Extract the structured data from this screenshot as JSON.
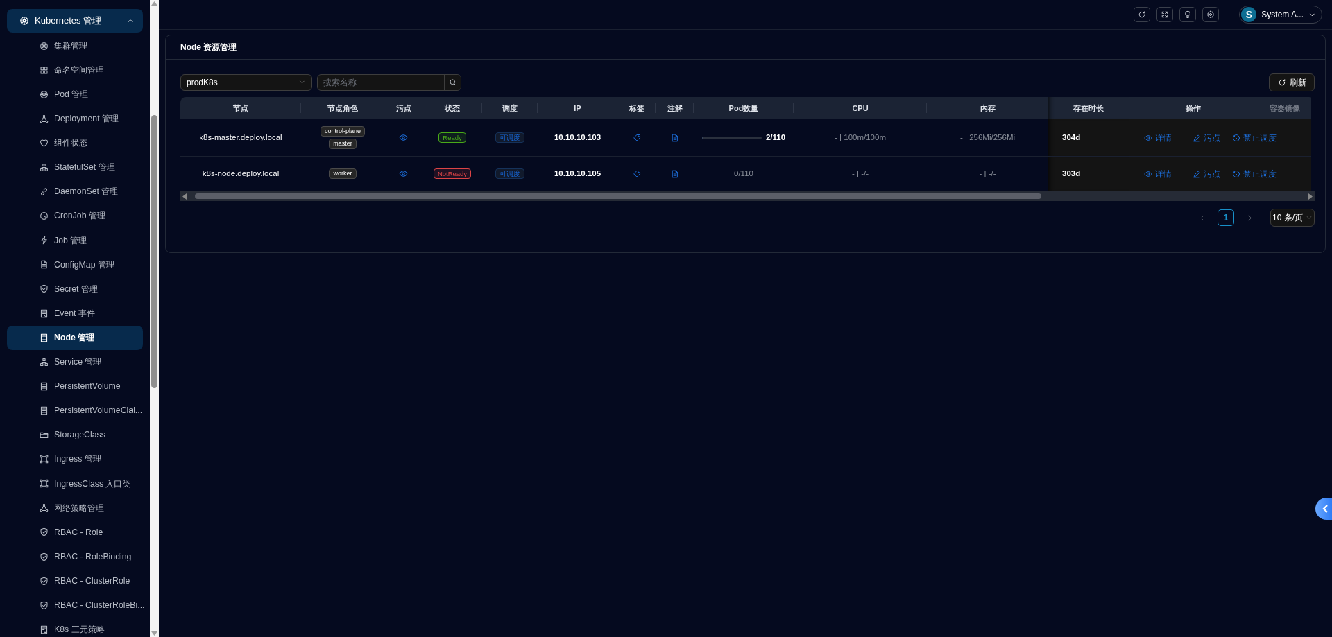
{
  "sidebar": {
    "group": {
      "label": "Kubernetes 管理",
      "expanded": true
    },
    "items": [
      {
        "label": "集群管理",
        "selected": false
      },
      {
        "label": "命名空间管理",
        "selected": false
      },
      {
        "label": "Pod 管理",
        "selected": false
      },
      {
        "label": "Deployment 管理",
        "selected": false
      },
      {
        "label": "组件状态",
        "selected": false
      },
      {
        "label": "StatefulSet 管理",
        "selected": false
      },
      {
        "label": "DaemonSet 管理",
        "selected": false
      },
      {
        "label": "CronJob 管理",
        "selected": false
      },
      {
        "label": "Job 管理",
        "selected": false
      },
      {
        "label": "ConfigMap 管理",
        "selected": false
      },
      {
        "label": "Secret 管理",
        "selected": false
      },
      {
        "label": "Event 事件",
        "selected": false
      },
      {
        "label": "Node 管理",
        "selected": true
      },
      {
        "label": "Service 管理",
        "selected": false
      },
      {
        "label": "PersistentVolume",
        "selected": false
      },
      {
        "label": "PersistentVolumeClai...",
        "selected": false
      },
      {
        "label": "StorageClass",
        "selected": false
      },
      {
        "label": "Ingress 管理",
        "selected": false
      },
      {
        "label": "IngressClass 入口类",
        "selected": false
      },
      {
        "label": "网络策略管理",
        "selected": false
      },
      {
        "label": "RBAC - Role",
        "selected": false
      },
      {
        "label": "RBAC - RoleBinding",
        "selected": false
      },
      {
        "label": "RBAC - ClusterRole",
        "selected": false
      },
      {
        "label": "RBAC - ClusterRoleBi...",
        "selected": false
      },
      {
        "label": "K8s 三元策略",
        "selected": false
      }
    ]
  },
  "topbar": {
    "user": {
      "avatar": "S",
      "name": "System A..."
    }
  },
  "panel": {
    "title": "Node 资源管理",
    "cluster_select": {
      "value": "prodK8s"
    },
    "search": {
      "placeholder": "搜索名称"
    },
    "refresh_button": "刷新",
    "table": {
      "columns": [
        {
          "label": "节点",
          "faded": false
        },
        {
          "label": "节点角色",
          "faded": false
        },
        {
          "label": "污点",
          "faded": false
        },
        {
          "label": "状态",
          "faded": false
        },
        {
          "label": "调度",
          "faded": false
        },
        {
          "label": "IP",
          "faded": false
        },
        {
          "label": "标签",
          "faded": false
        },
        {
          "label": "注解",
          "faded": false
        },
        {
          "label": "Pod数量",
          "faded": false
        },
        {
          "label": "CPU",
          "faded": false
        },
        {
          "label": "内存",
          "faded": false
        },
        {
          "label": "存在时长",
          "faded": false
        },
        {
          "label": "操作",
          "faded": false
        },
        {
          "label": "容器镜像",
          "faded": true
        }
      ],
      "rows": [
        {
          "node": "k8s-master.deploy.local",
          "roles": [
            "control-plane",
            "master"
          ],
          "status": {
            "label": "Ready",
            "color": "#49aa19"
          },
          "schedule": "可调度",
          "ip": "10.10.10.103",
          "pods": {
            "text": "2/110",
            "level": 0.018
          },
          "cpu": "- | 100m/100m",
          "memory": "- | 256Mi/256Mi",
          "age": "304d",
          "actions": [
            "详情",
            "污点",
            "禁止调度"
          ]
        },
        {
          "node": "k8s-node.deploy.local",
          "roles": [
            "worker"
          ],
          "status": {
            "label": "NotReady",
            "color": "#dc4446"
          },
          "schedule": "可调度",
          "ip": "10.10.10.105",
          "pods": {
            "text": "0/110"
          },
          "cpu": "- | -/-",
          "memory": "- | -/-",
          "age": "303d",
          "actions": [
            "详情",
            "污点",
            "禁止调度"
          ]
        }
      ]
    },
    "pagination": {
      "pages": [
        {
          "label": "1",
          "selected": true
        }
      ],
      "page_size": "10 条/页"
    }
  }
}
